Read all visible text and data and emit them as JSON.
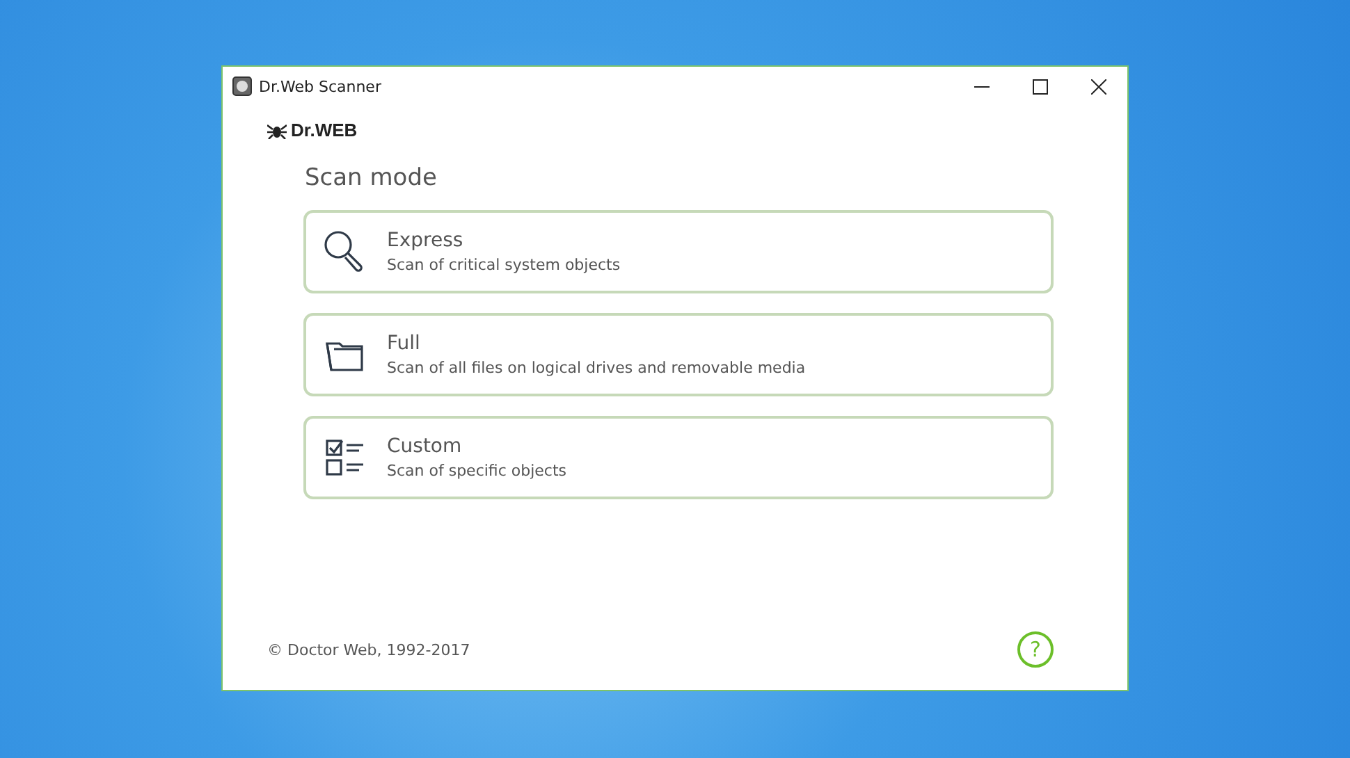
{
  "window": {
    "title": "Dr.Web Scanner"
  },
  "logo": {
    "text": "Dr.WEB"
  },
  "heading": "Scan mode",
  "modes": [
    {
      "kind": "express",
      "title": "Express",
      "description": "Scan of critical system objects"
    },
    {
      "kind": "full",
      "title": "Full",
      "description": "Scan of all files on logical drives and removable media"
    },
    {
      "kind": "custom",
      "title": "Custom",
      "description": "Scan of specific objects"
    }
  ],
  "footer": {
    "copyright": "© Doctor Web, 1992-2017",
    "help": "?"
  }
}
